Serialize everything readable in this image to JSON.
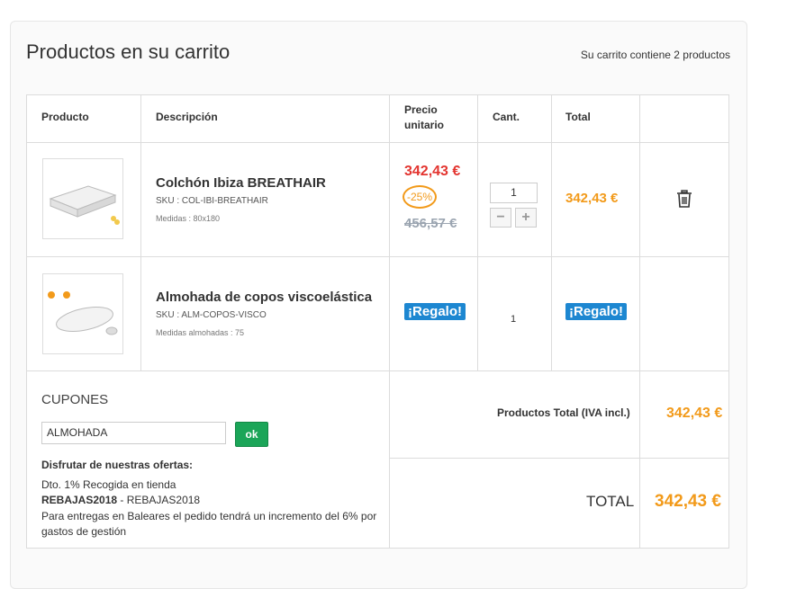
{
  "header": {
    "title": "Productos en su carrito",
    "count_text": "Su carrito contiene 2 productos"
  },
  "table": {
    "columns": {
      "product": "Producto",
      "description": "Descripción",
      "unit_price_1": "Precio",
      "unit_price_2": "unitario",
      "qty": "Cant.",
      "total": "Total"
    }
  },
  "items": [
    {
      "name": "Colchón Ibiza BREATHAIR",
      "sku": "SKU : COL-IBI-BREATHAIR",
      "measure": "Medidas : 80x180",
      "price": "342,43 €",
      "discount": "-25%",
      "old_price": "456,57 €",
      "qty": "1",
      "total": "342,43 €",
      "icon": "trash-icon"
    },
    {
      "name": "Almohada de copos viscoelástica",
      "sku": "SKU : ALM-COPOS-VISCO",
      "measure": "Medidas almohadas : 75",
      "price": "¡Regalo!",
      "qty": "1",
      "total": "¡Regalo!"
    }
  ],
  "coupons": {
    "title": "CUPONES",
    "input_value": "ALMOHADA",
    "ok_label": "ok",
    "offers_title": "Disfrutar de nuestras ofertas:",
    "offer_1": "Dto. 1% Recogida en tienda",
    "offer_2_code": "REBAJAS2018",
    "offer_2_rest": " - REBAJAS2018",
    "offer_3": "Para entregas en Baleares el pedido tendrá un incremento del 6% por gastos de gestión"
  },
  "totals": {
    "products_label": "Productos Total (IVA incl.)",
    "products_value": "342,43 €",
    "total_label": "TOTAL",
    "total_value": "342,43 €"
  },
  "colors": {
    "accent_orange": "#f29a1a",
    "price_red": "#e3342f",
    "gift_blue": "#1d87d1",
    "ok_green": "#1ba558"
  }
}
